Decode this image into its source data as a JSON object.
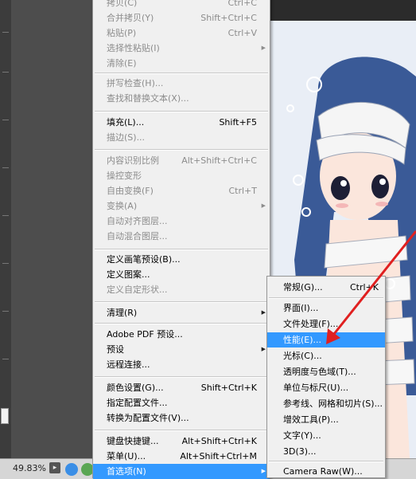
{
  "status_bar": {
    "zoom": "49.83%"
  },
  "edit_menu": {
    "items": [
      {
        "label": "拷贝(C)",
        "shortcut": "Ctrl+C",
        "disabled": true
      },
      {
        "label": "合并拷贝(Y)",
        "shortcut": "Shift+Ctrl+C",
        "disabled": true
      },
      {
        "label": "粘贴(P)",
        "shortcut": "Ctrl+V",
        "disabled": true
      },
      {
        "label": "选择性粘贴(I)",
        "shortcut": "",
        "disabled": true,
        "submenu": true
      },
      {
        "label": "清除(E)",
        "shortcut": "",
        "disabled": true
      },
      {
        "label": "拼写检查(H)...",
        "shortcut": "",
        "disabled": true
      },
      {
        "label": "查找和替换文本(X)...",
        "shortcut": "",
        "disabled": true
      },
      {
        "label": "填充(L)...",
        "shortcut": "Shift+F5",
        "disabled": false
      },
      {
        "label": "描边(S)...",
        "shortcut": "",
        "disabled": true
      },
      {
        "label": "内容识别比例",
        "shortcut": "Alt+Shift+Ctrl+C",
        "disabled": true
      },
      {
        "label": "操控变形",
        "shortcut": "",
        "disabled": true
      },
      {
        "label": "自由变换(F)",
        "shortcut": "Ctrl+T",
        "disabled": true
      },
      {
        "label": "变换(A)",
        "shortcut": "",
        "disabled": true,
        "submenu": true
      },
      {
        "label": "自动对齐图层...",
        "shortcut": "",
        "disabled": true
      },
      {
        "label": "自动混合图层...",
        "shortcut": "",
        "disabled": true
      },
      {
        "label": "定义画笔预设(B)...",
        "shortcut": "",
        "disabled": false
      },
      {
        "label": "定义图案...",
        "shortcut": "",
        "disabled": false
      },
      {
        "label": "定义自定形状...",
        "shortcut": "",
        "disabled": true
      },
      {
        "label": "清理(R)",
        "shortcut": "",
        "disabled": false,
        "submenu": true
      },
      {
        "label": "Adobe PDF 预设...",
        "shortcut": "",
        "disabled": false
      },
      {
        "label": "预设",
        "shortcut": "",
        "disabled": false,
        "submenu": true
      },
      {
        "label": "远程连接...",
        "shortcut": "",
        "disabled": false
      },
      {
        "label": "颜色设置(G)...",
        "shortcut": "Shift+Ctrl+K",
        "disabled": false
      },
      {
        "label": "指定配置文件...",
        "shortcut": "",
        "disabled": false
      },
      {
        "label": "转换为配置文件(V)...",
        "shortcut": "",
        "disabled": false
      },
      {
        "label": "键盘快捷键...",
        "shortcut": "Alt+Shift+Ctrl+K",
        "disabled": false
      },
      {
        "label": "菜单(U)...",
        "shortcut": "Alt+Shift+Ctrl+M",
        "disabled": false
      },
      {
        "label": "首选项(N)",
        "shortcut": "",
        "disabled": false,
        "submenu": true,
        "highlighted": true
      }
    ]
  },
  "prefs_menu": {
    "items": [
      {
        "label": "常规(G)...",
        "shortcut": "Ctrl+K"
      },
      {
        "label": "界面(I)...",
        "shortcut": ""
      },
      {
        "label": "文件处理(F)...",
        "shortcut": ""
      },
      {
        "label": "性能(E)...",
        "shortcut": "",
        "highlighted": true
      },
      {
        "label": "光标(C)...",
        "shortcut": ""
      },
      {
        "label": "透明度与色域(T)...",
        "shortcut": ""
      },
      {
        "label": "单位与标尺(U)...",
        "shortcut": ""
      },
      {
        "label": "参考线、网格和切片(S)...",
        "shortcut": ""
      },
      {
        "label": "增效工具(P)...",
        "shortcut": ""
      },
      {
        "label": "文字(Y)...",
        "shortcut": ""
      },
      {
        "label": "3D(3)...",
        "shortcut": ""
      },
      {
        "label": "Camera Raw(W)...",
        "shortcut": ""
      }
    ]
  },
  "colors": {
    "highlight": "#3399ff",
    "annotation_arrow": "#e02020",
    "menu_bg": "#f0f0f0"
  }
}
